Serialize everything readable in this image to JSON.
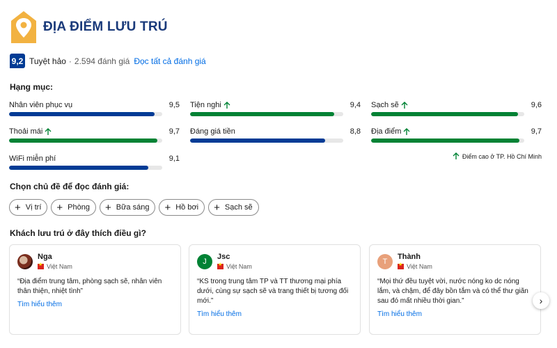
{
  "header": {
    "title": "ĐỊA ĐIỂM LƯU TRÚ",
    "logo_icon": "location-pin-icon",
    "logo_color": "#f2b241"
  },
  "score": {
    "value": "9,2",
    "word": "Tuyệt hảo",
    "separator": "·",
    "count": "2.594 đánh giá",
    "link": "Đọc tất cả đánh giá"
  },
  "categories_title": "Hạng mục:",
  "categories": [
    {
      "label": "Nhân viên phục vụ",
      "value": "9,5",
      "score": 9.5,
      "high": false
    },
    {
      "label": "Tiện nghi",
      "value": "9,4",
      "score": 9.4,
      "high": true
    },
    {
      "label": "Sạch sẽ",
      "value": "9,6",
      "score": 9.6,
      "high": true
    },
    {
      "label": "Thoải mái",
      "value": "9,7",
      "score": 9.7,
      "high": true
    },
    {
      "label": "Đáng giá tiền",
      "value": "8,8",
      "score": 8.8,
      "high": false
    },
    {
      "label": "Địa điểm",
      "value": "9,7",
      "score": 9.7,
      "high": true
    },
    {
      "label": "WiFi miễn phí",
      "value": "9,1",
      "score": 9.1,
      "high": false
    }
  ],
  "high_note": "Điểm cao ở TP. Hồ Chí Minh",
  "topics_title": "Chọn chủ đề để đọc đánh giá:",
  "topics": [
    "Vị trí",
    "Phòng",
    "Bữa sáng",
    "Hồ bơi",
    "Sạch sẽ"
  ],
  "reviews_title": "Khách lưu trú ở đây thích điều gì?",
  "reviews": [
    {
      "name": "Nga",
      "initial": "",
      "avatar_color": "",
      "country": "Việt Nam",
      "quote": "“Địa điểm trung tâm, phòng sạch sẽ, nhân viên thân thiện, nhiệt tình”",
      "link": "Tìm hiểu thêm"
    },
    {
      "name": "Jsc",
      "initial": "J",
      "avatar_color": "#008234",
      "country": "Việt Nam",
      "quote": "“KS trong trung tâm TP và TT thương mại phía dưới, cùng sự sạch sẽ và trang thiết bị tương đối mới.”",
      "link": "Tìm hiểu thêm"
    },
    {
      "name": "Thành",
      "initial": "T",
      "avatar_color": "#e8a07a",
      "country": "Việt Nam",
      "quote": "“Mọi thứ đều tuyệt vời, nước nóng ko dc nóng lắm, và chậm, để đây bồn tắm và có thể thư giãn sau đó mất nhiều thời gian.”",
      "link": "Tìm hiểu thêm"
    }
  ],
  "colors": {
    "blue": "#003b95",
    "green": "#008234",
    "link": "#006ce4"
  },
  "next_icon": "chevron-right-icon"
}
